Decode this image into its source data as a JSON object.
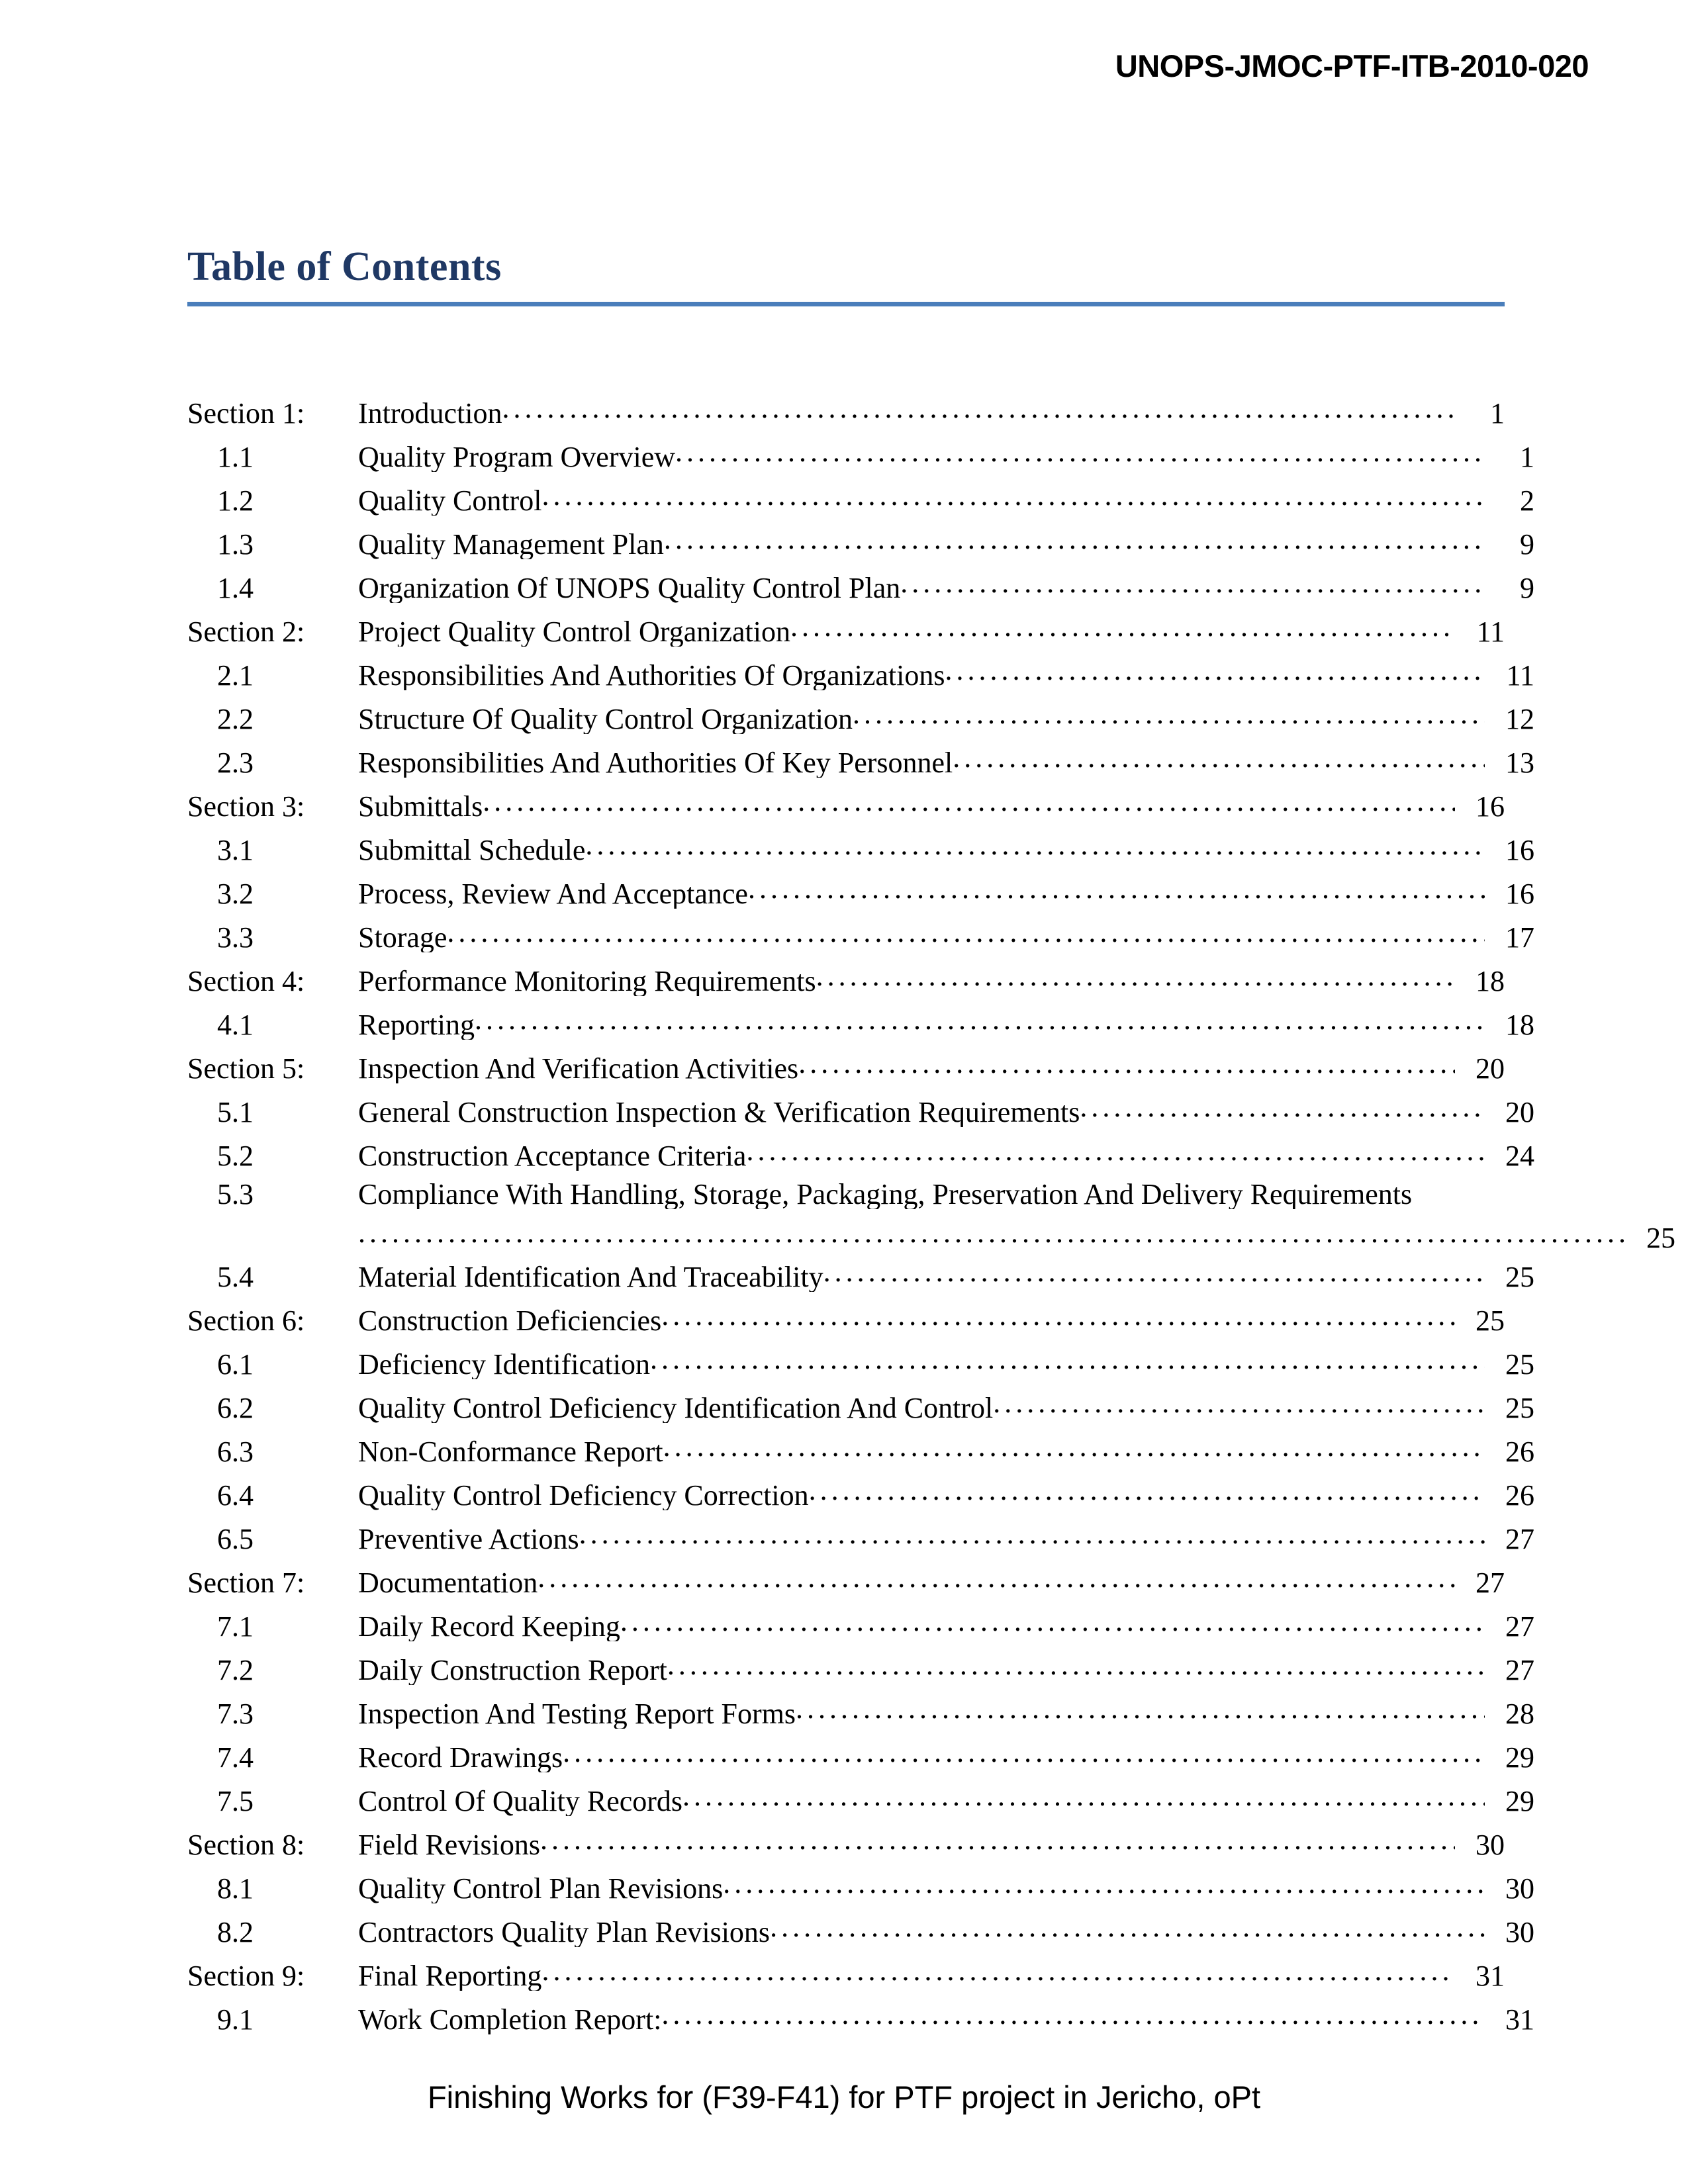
{
  "header": {
    "document_code": "UNOPS-JMOC-PTF-ITB-2010-020"
  },
  "title": {
    "text": "Table of Contents",
    "color": "#1f3864",
    "rule_color": "#4a7ebb"
  },
  "toc": {
    "entries": [
      {
        "level": 1,
        "number": "Section 1:",
        "label": "Introduction",
        "page": "1"
      },
      {
        "level": 2,
        "number": "1.1",
        "label": "Quality Program Overview",
        "page": "1"
      },
      {
        "level": 2,
        "number": "1.2",
        "label": "Quality Control",
        "page": "2"
      },
      {
        "level": 2,
        "number": "1.3",
        "label": "Quality Management Plan",
        "page": "9"
      },
      {
        "level": 2,
        "number": "1.4",
        "label": "Organization Of UNOPS Quality Control Plan",
        "page": "9"
      },
      {
        "level": 1,
        "number": "Section 2:",
        "label": "Project Quality Control Organization",
        "page": "11"
      },
      {
        "level": 2,
        "number": "2.1",
        "label": "Responsibilities And Authorities Of Organizations",
        "page": "11"
      },
      {
        "level": 2,
        "number": "2.2",
        "label": "Structure Of Quality Control Organization",
        "page": "12"
      },
      {
        "level": 2,
        "number": "2.3",
        "label": "Responsibilities And Authorities Of Key Personnel",
        "page": "13"
      },
      {
        "level": 1,
        "number": "Section 3:",
        "label": "Submittals",
        "page": "16"
      },
      {
        "level": 2,
        "number": "3.1",
        "label": "Submittal Schedule",
        "page": "16"
      },
      {
        "level": 2,
        "number": "3.2",
        "label": "Process, Review And Acceptance",
        "page": "16"
      },
      {
        "level": 2,
        "number": "3.3",
        "label": "Storage",
        "page": "17"
      },
      {
        "level": 1,
        "number": "Section 4:",
        "label": "Performance Monitoring Requirements",
        "page": "18"
      },
      {
        "level": 2,
        "number": "4.1",
        "label": "Reporting",
        "page": "18"
      },
      {
        "level": 1,
        "number": "Section 5:",
        "label": "Inspection And Verification Activities",
        "page": "20"
      },
      {
        "level": 2,
        "number": "5.1",
        "label": "General Construction Inspection & Verification Requirements",
        "page": "20"
      },
      {
        "level": 2,
        "number": "5.2",
        "label": "Construction Acceptance Criteria",
        "page": "24"
      },
      {
        "level": 2,
        "number": "5.3",
        "label": "Compliance With Handling, Storage, Packaging, Preservation And Delivery Requirements",
        "page": "25",
        "wrapped": true
      },
      {
        "level": 2,
        "number": "5.4",
        "label": "Material Identification And Traceability",
        "page": "25"
      },
      {
        "level": 1,
        "number": "Section 6:",
        "label": "Construction Deficiencies",
        "page": "25"
      },
      {
        "level": 2,
        "number": "6.1",
        "label": "Deficiency Identification",
        "page": "25"
      },
      {
        "level": 2,
        "number": "6.2",
        "label": "Quality Control Deficiency Identification And Control",
        "page": "25"
      },
      {
        "level": 2,
        "number": "6.3",
        "label": "Non-Conformance Report",
        "page": "26"
      },
      {
        "level": 2,
        "number": "6.4",
        "label": "Quality Control Deficiency Correction",
        "page": "26"
      },
      {
        "level": 2,
        "number": "6.5",
        "label": "Preventive Actions",
        "page": "27"
      },
      {
        "level": 1,
        "number": "Section 7:",
        "label": "Documentation",
        "page": "27"
      },
      {
        "level": 2,
        "number": "7.1",
        "label": "Daily Record Keeping",
        "page": "27"
      },
      {
        "level": 2,
        "number": "7.2",
        "label": "Daily Construction Report",
        "page": "27"
      },
      {
        "level": 2,
        "number": "7.3",
        "label": "Inspection And Testing Report Forms",
        "page": "28"
      },
      {
        "level": 2,
        "number": "7.4",
        "label": "Record Drawings",
        "page": "29"
      },
      {
        "level": 2,
        "number": "7.5",
        "label": "Control Of Quality Records",
        "page": "29"
      },
      {
        "level": 1,
        "number": "Section 8:",
        "label": "Field Revisions",
        "page": "30"
      },
      {
        "level": 2,
        "number": "8.1",
        "label": "Quality Control Plan Revisions",
        "page": "30"
      },
      {
        "level": 2,
        "number": "8.2",
        "label": "Contractors Quality Plan Revisions",
        "page": "30"
      },
      {
        "level": 1,
        "number": "Section 9:",
        "label": "Final Reporting",
        "page": "31"
      },
      {
        "level": 2,
        "number": "9.1",
        "label": "Work Completion Report:",
        "page": "31"
      }
    ]
  },
  "footer": {
    "text": "Finishing Works for (F39-F41) for PTF project in Jericho, oPt"
  }
}
